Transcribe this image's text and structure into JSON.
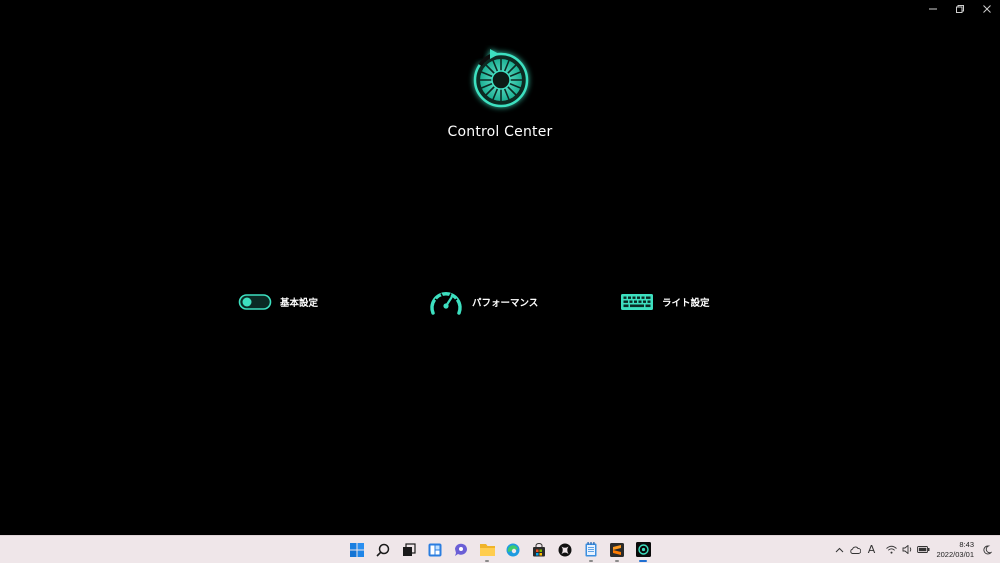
{
  "window": {
    "minimize_icon": "minimize-icon",
    "restore_icon": "restore-icon",
    "close_icon": "close-icon"
  },
  "app": {
    "title": "Control Center",
    "logo_icon": "control-center-logo",
    "accent_color": "#3de0c0"
  },
  "menu": {
    "items": [
      {
        "label": "基本設定",
        "icon": "toggle-switch-icon"
      },
      {
        "label": "パフォーマンス",
        "icon": "speedometer-icon"
      },
      {
        "label": "ライト設定",
        "icon": "keyboard-icon"
      }
    ]
  },
  "taskbar": {
    "apps": [
      {
        "icon": "windows-start-icon"
      },
      {
        "icon": "search-icon"
      },
      {
        "icon": "task-view-icon"
      },
      {
        "icon": "widgets-icon"
      },
      {
        "icon": "chat-icon"
      },
      {
        "icon": "file-explorer-icon"
      },
      {
        "icon": "edge-browser-icon"
      },
      {
        "icon": "store-icon"
      },
      {
        "icon": "xbox-icon"
      },
      {
        "icon": "notepad-icon"
      },
      {
        "icon": "sublime-app-icon"
      },
      {
        "icon": "control-center-app-icon"
      }
    ],
    "tray": {
      "ime_label": "A",
      "time": "8:43",
      "date": "2022/03/01"
    }
  }
}
